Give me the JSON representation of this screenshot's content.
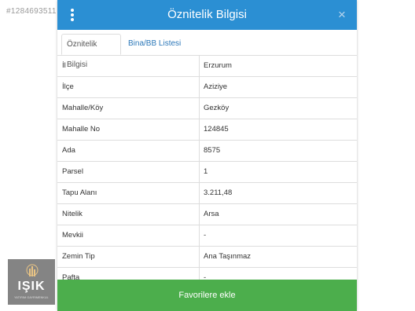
{
  "watermark_id": "#1284693511",
  "dialog": {
    "title": "Öznitelik Bilgisi",
    "close_symbol": "×",
    "menu_icon": "vertical-dots-icon",
    "colors": {
      "header": "#2b8fd3",
      "button": "#4cae4c",
      "tab_link": "#2b77b8"
    }
  },
  "tabs": [
    {
      "label": "Öznitelik Bilgisi",
      "active": true
    },
    {
      "label": "Bina/BB Listesi",
      "active": false
    }
  ],
  "attributes": [
    {
      "key": "İl",
      "value": "Erzurum"
    },
    {
      "key": "İlçe",
      "value": "Aziziye"
    },
    {
      "key": "Mahalle/Köy",
      "value": "Gezköy"
    },
    {
      "key": "Mahalle No",
      "value": "124845"
    },
    {
      "key": "Ada",
      "value": "8575"
    },
    {
      "key": "Parsel",
      "value": "1"
    },
    {
      "key": "Tapu Alanı",
      "value": "3.211,48"
    },
    {
      "key": "Nitelik",
      "value": "Arsa"
    },
    {
      "key": "Mevkii",
      "value": "-"
    },
    {
      "key": "Zemin Tip",
      "value": "Ana Taşınmaz"
    },
    {
      "key": "Pafta",
      "value": "-"
    }
  ],
  "favorite_button": "Favorilere ekle",
  "logo": {
    "text": "IŞIK",
    "subtext": "YATIRIM GAYRIMENKUL"
  }
}
